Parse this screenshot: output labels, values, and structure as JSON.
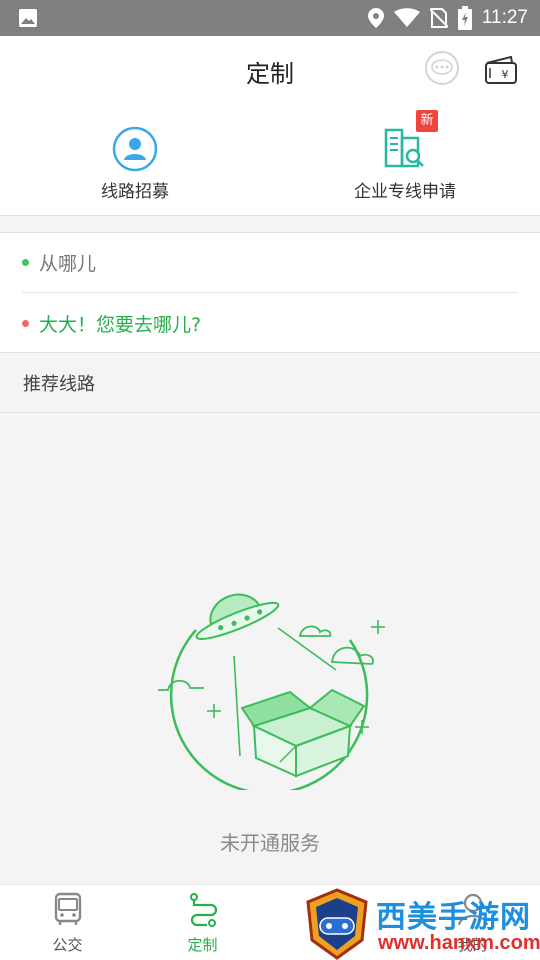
{
  "status_bar": {
    "time": "11:27"
  },
  "header": {
    "title": "定制"
  },
  "entries": [
    {
      "label": "线路招募",
      "icon": "recruit-icon"
    },
    {
      "label": "企业专线申请",
      "icon": "enterprise-icon",
      "badge": "新"
    }
  ],
  "search": {
    "from_placeholder": "从哪儿",
    "to_placeholder": "大大！您要去哪儿?"
  },
  "recommend": {
    "title": "推荐线路"
  },
  "empty": {
    "text": "未开通服务"
  },
  "tabs": [
    {
      "label": "公交",
      "icon": "bus-icon",
      "active": false
    },
    {
      "label": "定制",
      "icon": "route-icon",
      "active": true
    },
    {
      "label": "",
      "icon": "hidden-tab"
    },
    {
      "label": "我的",
      "icon": "profile-icon",
      "active": false
    }
  ],
  "watermark": {
    "title": "西美手游网",
    "url": "www.hanxm.com"
  },
  "colors": {
    "accent": "#25b04b",
    "badge": "#f0443c",
    "status_bar": "#808080"
  }
}
